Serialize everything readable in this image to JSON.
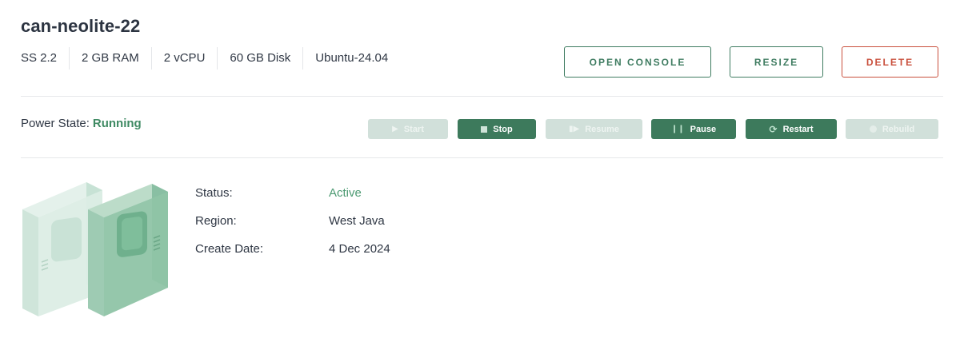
{
  "server": {
    "name": "can-neolite-22",
    "specs": [
      "SS 2.2",
      "2 GB RAM",
      "2 vCPU",
      "60 GB Disk",
      "Ubuntu-24.04"
    ]
  },
  "actions": {
    "open_console": "OPEN CONSOLE",
    "resize": "RESIZE",
    "delete": "DELETE"
  },
  "power": {
    "label": "Power State:",
    "state": "Running",
    "buttons": {
      "start": "Start",
      "stop": "Stop",
      "resume": "Resume",
      "pause": "Pause",
      "restart": "Restart",
      "rebuild": "Rebuild"
    }
  },
  "details": {
    "status_label": "Status:",
    "status_value": "Active",
    "region_label": "Region:",
    "region_value": "West Java",
    "date_label": "Create Date:",
    "date_value": "4 Dec 2024"
  },
  "colors": {
    "accent": "#3f7c61",
    "danger": "#c9503d",
    "running": "#3f8a63"
  }
}
